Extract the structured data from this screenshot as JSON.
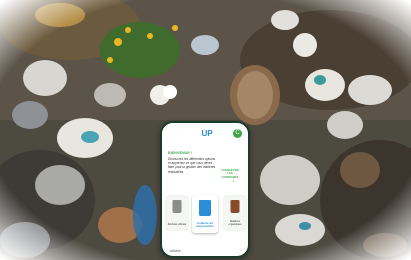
{
  "app": {
    "logo_text": "UP",
    "header_badge": "C"
  },
  "content": {
    "greeting": "BIENVENUE !",
    "intro": "Découvrez les différentes options et apprenez ce que vous devez faire pour la gestion des matières résiduelles.",
    "side_link": "CONSULTER LES CONSIGNES",
    "bottom_label": "Articles"
  },
  "bins": [
    {
      "label": "Déchets ultimes",
      "color": "#8c8c8c"
    },
    {
      "label": "Collecte de récupération",
      "color": "#2a8fd6"
    },
    {
      "label": "Matières organiques",
      "color": "#8a4b2d"
    }
  ]
}
